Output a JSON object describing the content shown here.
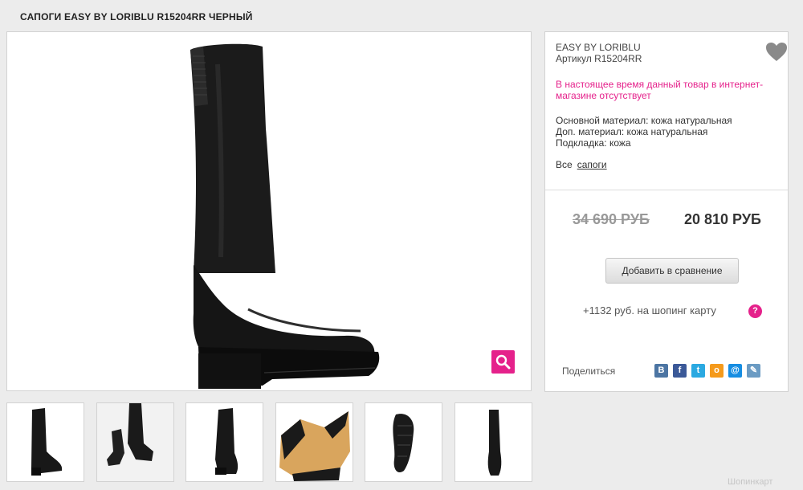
{
  "page": {
    "title": "САПОГИ EASY BY LORIBLU R15204RR ЧЕРНЫЙ"
  },
  "product": {
    "brand": "EASY BY LORIBLU",
    "article": "Артикул R15204RR",
    "availability_notice": "В настоящее время данный товар в интернет-магазине отсутствует",
    "specs": [
      "Основной материал: кожа натуральная",
      "Доп. материал: кожа натуральная",
      "Подкладка: кожа"
    ],
    "breadcrumb": {
      "all_label": "Все",
      "category_link": "сапоги"
    },
    "old_price": "34 690 РУБ",
    "price": "20 810 РУБ",
    "compare_button": "Добавить в сравнение",
    "bonus_text": "+1132 руб. на шопинг карту",
    "help_icon_text": "?",
    "share_label": "Поделиться",
    "social": [
      {
        "name": "vk",
        "glyph": "В",
        "color": "#4c75a3"
      },
      {
        "name": "facebook",
        "glyph": "f",
        "color": "#3b5998"
      },
      {
        "name": "twitter",
        "glyph": "t",
        "color": "#2ba9e1"
      },
      {
        "name": "odnoklassniki",
        "glyph": "о",
        "color": "#f59a1b"
      },
      {
        "name": "mailru",
        "glyph": "@",
        "color": "#168de2"
      },
      {
        "name": "livejournal",
        "glyph": "✎",
        "color": "#6b9bc3"
      }
    ]
  },
  "colors": {
    "accent": "#e5218b",
    "page_bg": "#ececec",
    "border": "#d2d2d2"
  },
  "icons": {
    "zoom": "search-icon",
    "favorite": "heart-icon",
    "help": "question-icon"
  },
  "thumbnails_count": 6,
  "watermark": "Шопинкарт"
}
